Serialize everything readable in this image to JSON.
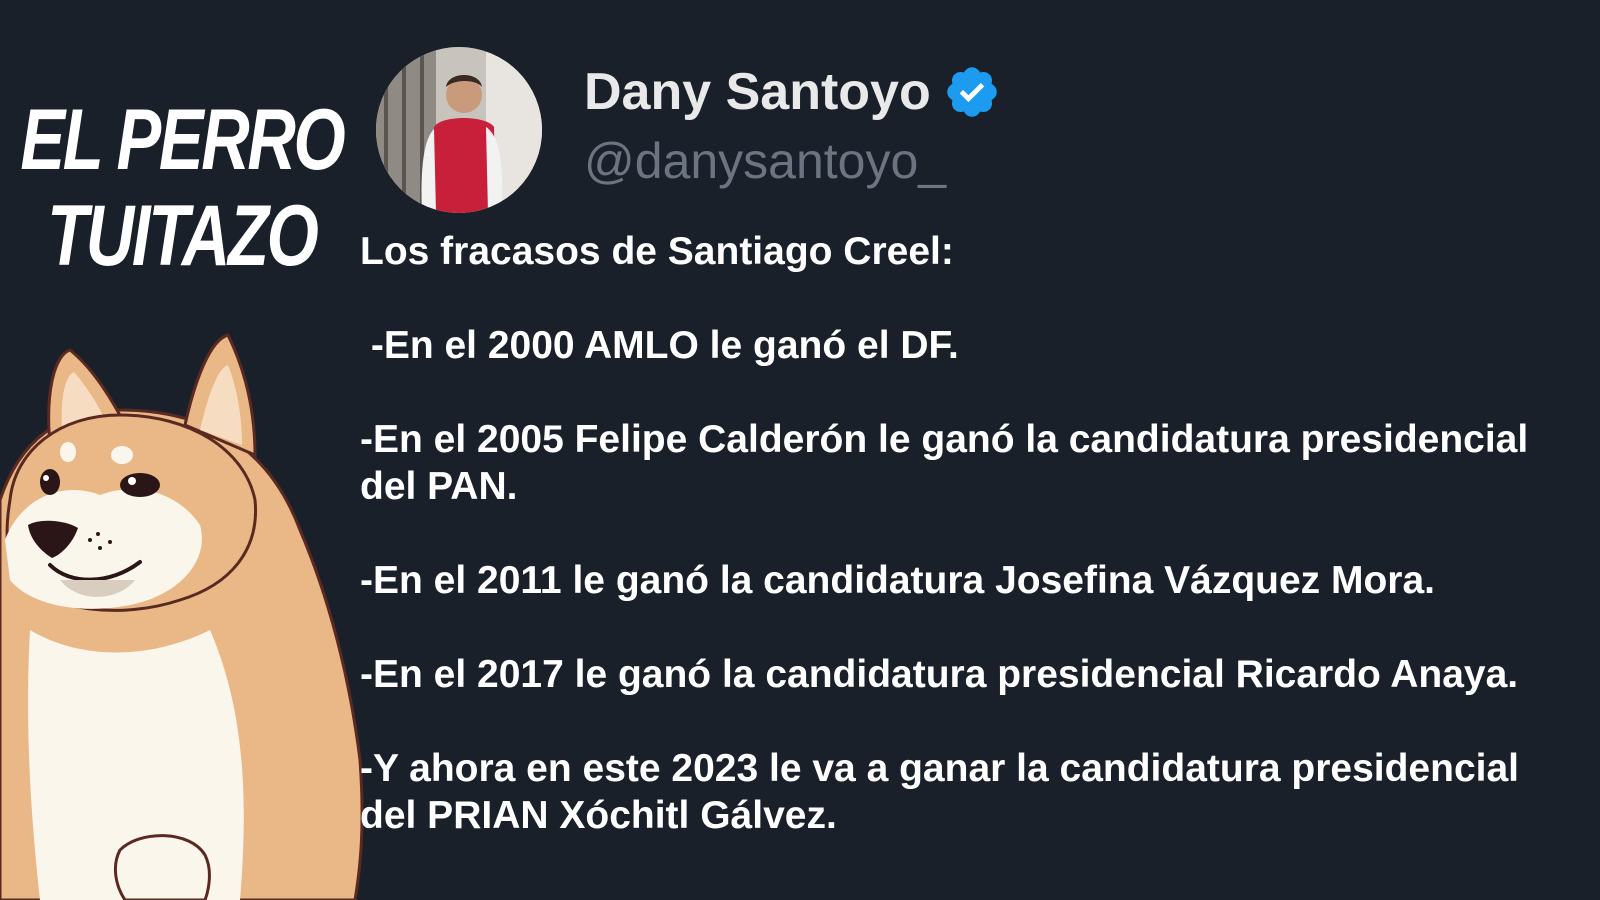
{
  "brand": {
    "line1": "EL PERRO",
    "line2": "TUITAZO"
  },
  "account": {
    "name": "Dany Santoyo",
    "handle": "@danysantoyo_",
    "verified_color": "#1d9bf0"
  },
  "tweet": {
    "heading": "Los fracasos de Santiago Creel:",
    "items": [
      " -En el 2000 AMLO le ganó el DF.",
      "-En el 2005 Felipe Calderón le ganó la candidatura presidencial del PAN.",
      "-En el 2011 le ganó la candidatura Josefina Vázquez Mora.",
      "-En el 2017 le ganó la candidatura presidencial Ricardo Anaya.",
      "-Y ahora en este 2023 le va a ganar la candidatura presidencial del PRIAN Xóchitl Gálvez."
    ]
  },
  "colors": {
    "background": "#19202a",
    "text": "#ffffff",
    "handle": "#6b7480"
  }
}
